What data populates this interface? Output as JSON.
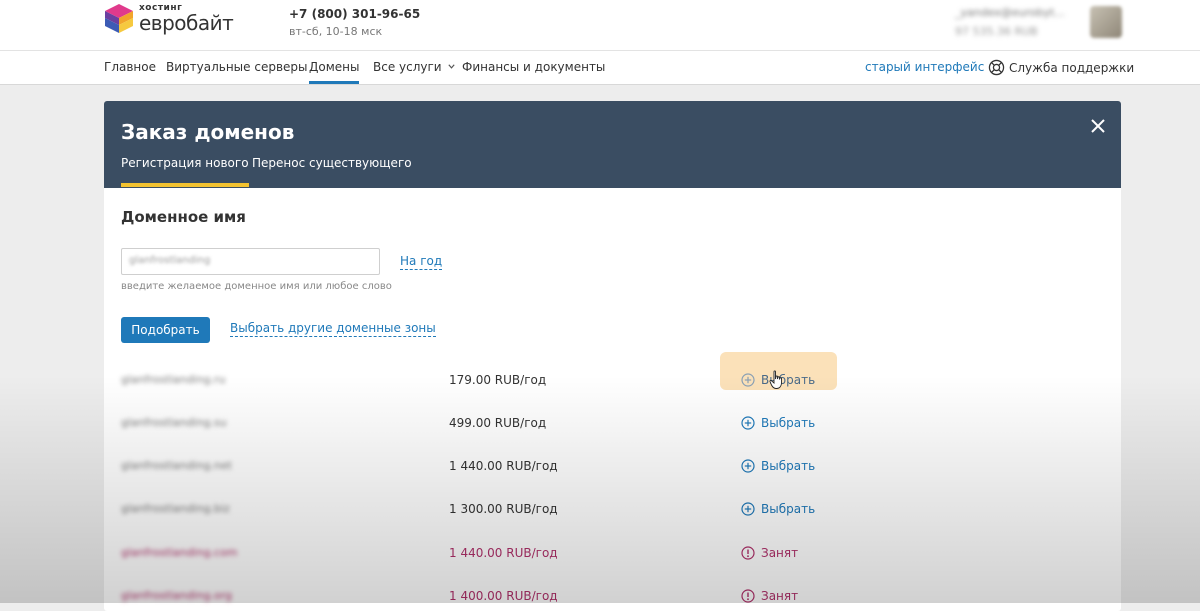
{
  "header": {
    "logo_small": "хостинг",
    "logo_big": "евробайт",
    "phone": "+7 (800) 301-96-65",
    "hours": "вт-сб, 10-18 мск",
    "account_email": "_yandex@eurobyt...",
    "account_balance": "97 535.36 RUB"
  },
  "nav": {
    "items": [
      {
        "label": "Главное"
      },
      {
        "label": "Виртуальные серверы"
      },
      {
        "label": "Домены",
        "active": true
      },
      {
        "label": "Все услуги"
      },
      {
        "label": "Финансы и документы"
      }
    ],
    "old_interface": "старый интерфейс",
    "support": "Служба поддержки"
  },
  "modal": {
    "title": "Заказ доменов",
    "tabs": [
      {
        "label": "Регистрация нового",
        "active": true
      },
      {
        "label": "Перенос существующего"
      }
    ],
    "section_title": "Доменное имя",
    "domain_input": {
      "value": "glanfrostlanding"
    },
    "period_link": "На год",
    "hint": "введите желаемое доменное имя или любое слово",
    "pick_button": "Подобрать",
    "zones_link": "Выбрать другие доменные зоны"
  },
  "results": [
    {
      "domain": "glanfrostlanding.ru",
      "price": "179.00 RUB/год",
      "action": "Выбрать",
      "status": "available",
      "hover": true
    },
    {
      "domain": "glanfrostlanding.su",
      "price": "499.00 RUB/год",
      "action": "Выбрать",
      "status": "available"
    },
    {
      "domain": "glanfrostlanding.net",
      "price": "1 440.00 RUB/год",
      "action": "Выбрать",
      "status": "available"
    },
    {
      "domain": "glanfrostlanding.biz",
      "price": "1 300.00 RUB/год",
      "action": "Выбрать",
      "status": "available"
    },
    {
      "domain": "glanfrostlanding.com",
      "price": "1 440.00 RUB/год",
      "action": "Занят",
      "status": "taken"
    },
    {
      "domain": "glanfrostlanding.org",
      "price": "1 400.00 RUB/год",
      "action": "Занят",
      "status": "taken"
    }
  ],
  "colors": {
    "accent": "#1f79b9",
    "modal_header": "#3a4d62",
    "tab_underline": "#f2c230",
    "taken": "#b0306a",
    "hover_highlight": "#fbe1b9"
  },
  "icons": {
    "close": "close-icon",
    "add": "plus-circle-icon",
    "taken": "exclamation-circle-icon",
    "support": "lifebuoy-icon",
    "nav_dropdown": "chevron-down-icon",
    "cursor": "hand-pointer-icon"
  }
}
